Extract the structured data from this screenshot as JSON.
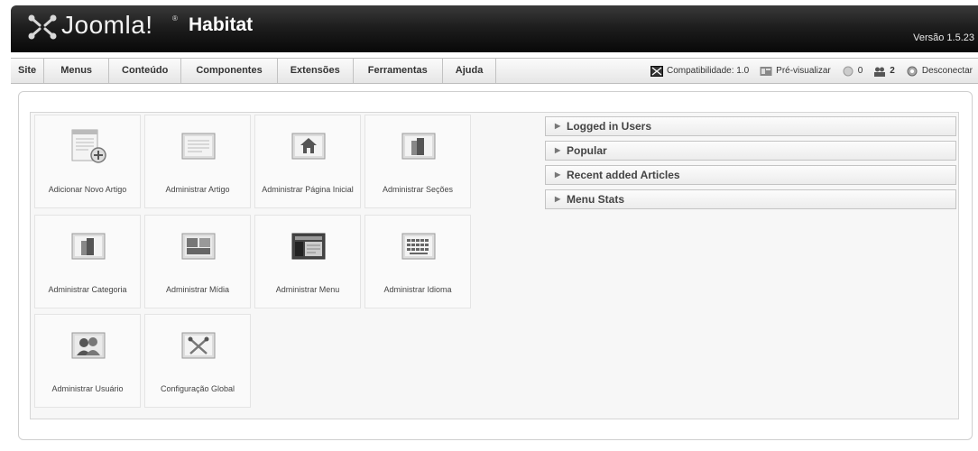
{
  "header": {
    "logo_text": "Joomla!",
    "logo_tm": "®",
    "site_name": "Habitat",
    "version": "Versão 1.5.23"
  },
  "menubar": {
    "items": [
      "Site",
      "Menus",
      "Conteúdo",
      "Componentes",
      "Extensões",
      "Ferramentas",
      "Ajuda"
    ]
  },
  "status": {
    "compat": "Compatibilidade: 1.0",
    "preview": "Pré-visualizar",
    "messages_count": "0",
    "users_count": "2",
    "logout": "Desconectar"
  },
  "cpanel": {
    "icons": [
      {
        "label": "Adicionar Novo Artigo",
        "icon": "add-article-icon"
      },
      {
        "label": "Administrar Artigo",
        "icon": "article-icon"
      },
      {
        "label": "Administrar Página Inicial",
        "icon": "frontpage-icon"
      },
      {
        "label": "Administrar Seções",
        "icon": "sections-icon"
      },
      {
        "label": "Administrar Categoria",
        "icon": "category-icon"
      },
      {
        "label": "Administrar Mídia",
        "icon": "media-icon"
      },
      {
        "label": "Administrar Menu",
        "icon": "menu-icon"
      },
      {
        "label": "Administrar Idioma",
        "icon": "language-icon"
      },
      {
        "label": "Administrar Usuário",
        "icon": "users-icon"
      },
      {
        "label": "Configuração Global",
        "icon": "config-icon"
      }
    ]
  },
  "panels": {
    "items": [
      "Logged in Users",
      "Popular",
      "Recent added Articles",
      "Menu Stats"
    ]
  }
}
